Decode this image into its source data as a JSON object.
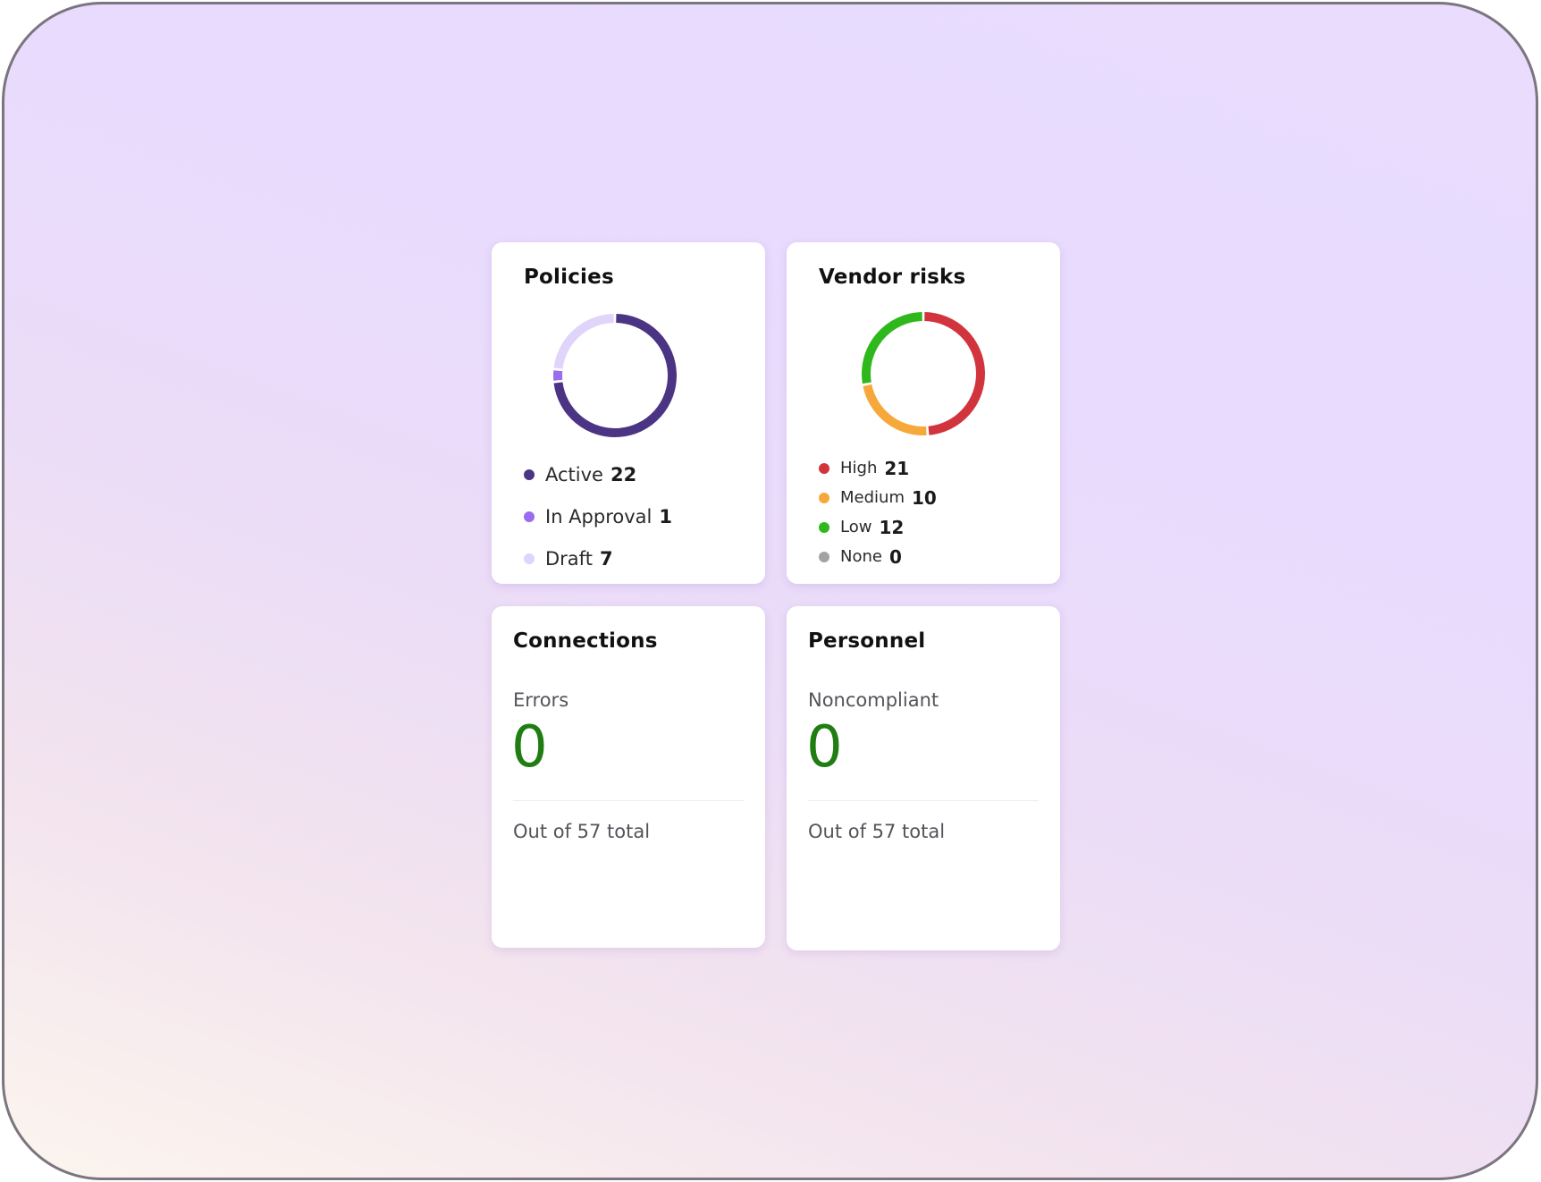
{
  "policies": {
    "title": "Policies",
    "legend": [
      {
        "label": "Active",
        "value": "22",
        "color": "#4b3484"
      },
      {
        "label": "In Approval",
        "value": "1",
        "color": "#9a6cf0"
      },
      {
        "label": "Draft",
        "value": "7",
        "color": "#e0d4fb"
      }
    ],
    "chart_data": {
      "type": "pie",
      "categories": [
        "Active",
        "In Approval",
        "Draft"
      ],
      "values": [
        22,
        1,
        7
      ]
    }
  },
  "vendor_risks": {
    "title": "Vendor risks",
    "legend": [
      {
        "label": "High",
        "value": "21",
        "color": "#d2343e"
      },
      {
        "label": "Medium",
        "value": "10",
        "color": "#f7a83a"
      },
      {
        "label": "Low",
        "value": "12",
        "color": "#2fb81c"
      },
      {
        "label": "None",
        "value": "0",
        "color": "#a3a3a3"
      }
    ],
    "chart_data": {
      "type": "pie",
      "categories": [
        "High",
        "Medium",
        "Low",
        "None"
      ],
      "values": [
        21,
        10,
        12,
        0
      ]
    }
  },
  "connections": {
    "title": "Connections",
    "metric_label": "Errors",
    "metric_value": "0",
    "footer": "Out of 57 total"
  },
  "personnel": {
    "title": "Personnel",
    "metric_label": "Noncompliant",
    "metric_value": "0",
    "footer": "Out of 57 total"
  }
}
